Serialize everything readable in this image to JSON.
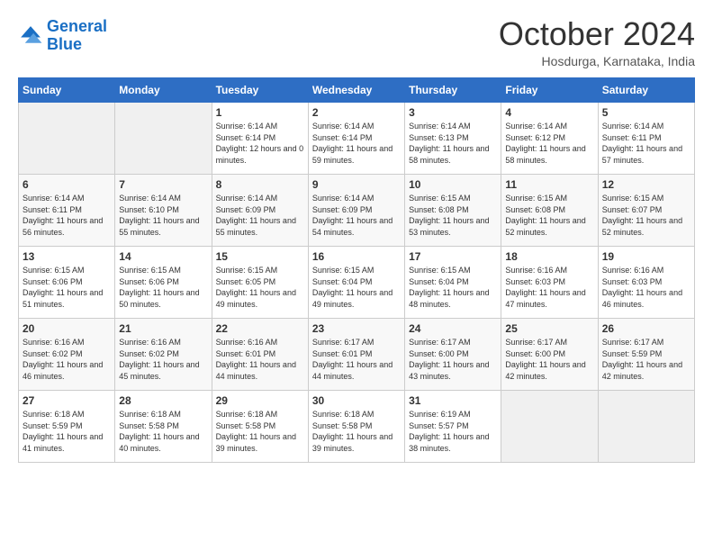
{
  "header": {
    "logo_line1": "General",
    "logo_line2": "Blue",
    "month_title": "October 2024",
    "location": "Hosdurga, Karnataka, India"
  },
  "days_of_week": [
    "Sunday",
    "Monday",
    "Tuesday",
    "Wednesday",
    "Thursday",
    "Friday",
    "Saturday"
  ],
  "weeks": [
    [
      {
        "day": "",
        "info": ""
      },
      {
        "day": "",
        "info": ""
      },
      {
        "day": "1",
        "info": "Sunrise: 6:14 AM\nSunset: 6:14 PM\nDaylight: 12 hours and 0 minutes."
      },
      {
        "day": "2",
        "info": "Sunrise: 6:14 AM\nSunset: 6:14 PM\nDaylight: 11 hours and 59 minutes."
      },
      {
        "day": "3",
        "info": "Sunrise: 6:14 AM\nSunset: 6:13 PM\nDaylight: 11 hours and 58 minutes."
      },
      {
        "day": "4",
        "info": "Sunrise: 6:14 AM\nSunset: 6:12 PM\nDaylight: 11 hours and 58 minutes."
      },
      {
        "day": "5",
        "info": "Sunrise: 6:14 AM\nSunset: 6:11 PM\nDaylight: 11 hours and 57 minutes."
      }
    ],
    [
      {
        "day": "6",
        "info": "Sunrise: 6:14 AM\nSunset: 6:11 PM\nDaylight: 11 hours and 56 minutes."
      },
      {
        "day": "7",
        "info": "Sunrise: 6:14 AM\nSunset: 6:10 PM\nDaylight: 11 hours and 55 minutes."
      },
      {
        "day": "8",
        "info": "Sunrise: 6:14 AM\nSunset: 6:09 PM\nDaylight: 11 hours and 55 minutes."
      },
      {
        "day": "9",
        "info": "Sunrise: 6:14 AM\nSunset: 6:09 PM\nDaylight: 11 hours and 54 minutes."
      },
      {
        "day": "10",
        "info": "Sunrise: 6:15 AM\nSunset: 6:08 PM\nDaylight: 11 hours and 53 minutes."
      },
      {
        "day": "11",
        "info": "Sunrise: 6:15 AM\nSunset: 6:08 PM\nDaylight: 11 hours and 52 minutes."
      },
      {
        "day": "12",
        "info": "Sunrise: 6:15 AM\nSunset: 6:07 PM\nDaylight: 11 hours and 52 minutes."
      }
    ],
    [
      {
        "day": "13",
        "info": "Sunrise: 6:15 AM\nSunset: 6:06 PM\nDaylight: 11 hours and 51 minutes."
      },
      {
        "day": "14",
        "info": "Sunrise: 6:15 AM\nSunset: 6:06 PM\nDaylight: 11 hours and 50 minutes."
      },
      {
        "day": "15",
        "info": "Sunrise: 6:15 AM\nSunset: 6:05 PM\nDaylight: 11 hours and 49 minutes."
      },
      {
        "day": "16",
        "info": "Sunrise: 6:15 AM\nSunset: 6:04 PM\nDaylight: 11 hours and 49 minutes."
      },
      {
        "day": "17",
        "info": "Sunrise: 6:15 AM\nSunset: 6:04 PM\nDaylight: 11 hours and 48 minutes."
      },
      {
        "day": "18",
        "info": "Sunrise: 6:16 AM\nSunset: 6:03 PM\nDaylight: 11 hours and 47 minutes."
      },
      {
        "day": "19",
        "info": "Sunrise: 6:16 AM\nSunset: 6:03 PM\nDaylight: 11 hours and 46 minutes."
      }
    ],
    [
      {
        "day": "20",
        "info": "Sunrise: 6:16 AM\nSunset: 6:02 PM\nDaylight: 11 hours and 46 minutes."
      },
      {
        "day": "21",
        "info": "Sunrise: 6:16 AM\nSunset: 6:02 PM\nDaylight: 11 hours and 45 minutes."
      },
      {
        "day": "22",
        "info": "Sunrise: 6:16 AM\nSunset: 6:01 PM\nDaylight: 11 hours and 44 minutes."
      },
      {
        "day": "23",
        "info": "Sunrise: 6:17 AM\nSunset: 6:01 PM\nDaylight: 11 hours and 44 minutes."
      },
      {
        "day": "24",
        "info": "Sunrise: 6:17 AM\nSunset: 6:00 PM\nDaylight: 11 hours and 43 minutes."
      },
      {
        "day": "25",
        "info": "Sunrise: 6:17 AM\nSunset: 6:00 PM\nDaylight: 11 hours and 42 minutes."
      },
      {
        "day": "26",
        "info": "Sunrise: 6:17 AM\nSunset: 5:59 PM\nDaylight: 11 hours and 42 minutes."
      }
    ],
    [
      {
        "day": "27",
        "info": "Sunrise: 6:18 AM\nSunset: 5:59 PM\nDaylight: 11 hours and 41 minutes."
      },
      {
        "day": "28",
        "info": "Sunrise: 6:18 AM\nSunset: 5:58 PM\nDaylight: 11 hours and 40 minutes."
      },
      {
        "day": "29",
        "info": "Sunrise: 6:18 AM\nSunset: 5:58 PM\nDaylight: 11 hours and 39 minutes."
      },
      {
        "day": "30",
        "info": "Sunrise: 6:18 AM\nSunset: 5:58 PM\nDaylight: 11 hours and 39 minutes."
      },
      {
        "day": "31",
        "info": "Sunrise: 6:19 AM\nSunset: 5:57 PM\nDaylight: 11 hours and 38 minutes."
      },
      {
        "day": "",
        "info": ""
      },
      {
        "day": "",
        "info": ""
      }
    ]
  ]
}
